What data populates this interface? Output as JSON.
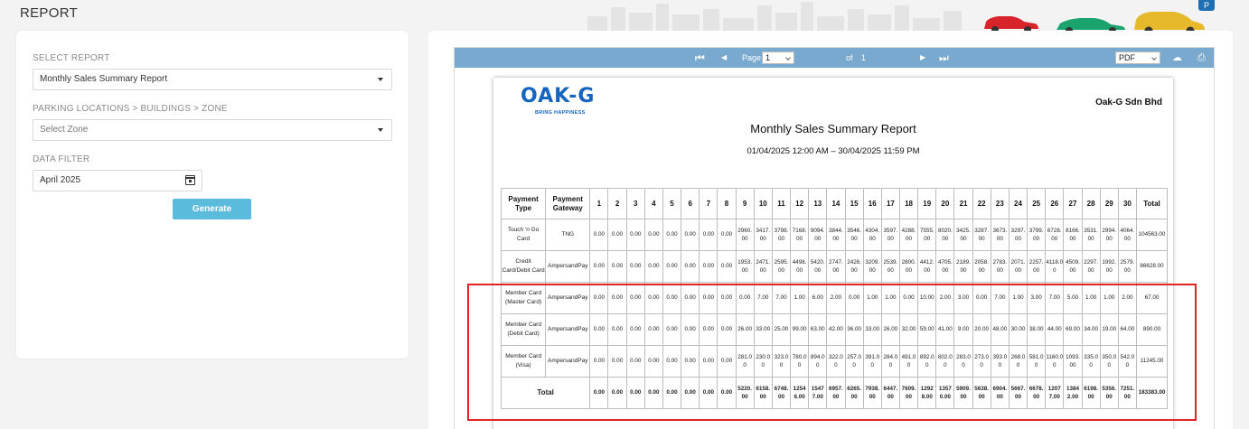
{
  "page": {
    "title": "REPORT"
  },
  "form": {
    "select_report_label": "SELECT REPORT",
    "select_report_value": "Monthly Sales Summary Report",
    "zone_label": "PARKING LOCATIONS > BUILDINGS > ZONE",
    "zone_placeholder": "Select Zone",
    "filter_label": "DATA FILTER",
    "filter_value": "April 2025",
    "generate_label": "Generate"
  },
  "viewer": {
    "page_label": "Page",
    "page_value": "1",
    "of_label": "of",
    "total_pages": "1",
    "format_value": "PDF"
  },
  "report": {
    "logo_text": "OAK-G",
    "logo_tagline": "BRING HAPPINESS",
    "company": "Oak-G Sdn Bhd",
    "title": "Monthly Sales Summary Report",
    "range": "01/04/2025 12:00 AM – 30/04/2025 11:59 PM",
    "headers": [
      "Payment Type",
      "Payment Gateway",
      "1",
      "2",
      "3",
      "4",
      "5",
      "6",
      "7",
      "8",
      "9",
      "10",
      "11",
      "12",
      "13",
      "14",
      "15",
      "16",
      "17",
      "18",
      "19",
      "20",
      "21",
      "22",
      "23",
      "24",
      "25",
      "26",
      "27",
      "28",
      "29",
      "30",
      "Total"
    ],
    "rows": [
      {
        "type": "Touch 'n Go Card",
        "gateway": "TNG",
        "values": [
          "0.00",
          "0.00",
          "0.00",
          "0.00",
          "0.00",
          "0.00",
          "0.00",
          "0.00",
          "2960.00",
          "3417.00",
          "3798.00",
          "7168.00",
          "9094.00",
          "3844.00",
          "3546.00",
          "4304.00",
          "3597.00",
          "4288.00",
          "7555.00",
          "8020.00",
          "3425.00",
          "3287.00",
          "3673.00",
          "3297.00",
          "3799.00",
          "6728.00",
          "8166.00",
          "3531.00",
          "2994.00",
          "4064.00"
        ],
        "total": "104563.00"
      },
      {
        "type": "Credit Card/Debit Card",
        "gateway": "AmpersandPay",
        "values": [
          "0.00",
          "0.00",
          "0.00",
          "0.00",
          "0.00",
          "0.00",
          "0.00",
          "0.00",
          "1953.00",
          "2471.00",
          "2595.00",
          "4498.00",
          "5420.00",
          "2747.00",
          "2426.00",
          "3209.00",
          "2539.00",
          "2800.00",
          "4412.00",
          "4705.00",
          "2189.00",
          "2058.00",
          "2783.00",
          "2071.00",
          "2257.00",
          "4118.00",
          "4509.00",
          "2297.00",
          "1992.00",
          "2579.00"
        ],
        "total": "86628.00"
      },
      {
        "type": "Member Card (Master Card)",
        "gateway": "AmpersandPay",
        "values": [
          "0.00",
          "0.00",
          "0.00",
          "0.00",
          "0.00",
          "0.00",
          "0.00",
          "0.00",
          "0.00",
          "7.00",
          "7.00",
          "1.00",
          "6.00",
          "2.00",
          "0.00",
          "1.00",
          "1.00",
          "0.00",
          "10.00",
          "2.00",
          "3.00",
          "0.00",
          "7.00",
          "1.00",
          "3.00",
          "7.00",
          "5.00",
          "1.00",
          "1.00",
          "2.00"
        ],
        "total": "67.00"
      },
      {
        "type": "Member Card (Debit Card)",
        "gateway": "AmpersandPay",
        "values": [
          "0.00",
          "0.00",
          "0.00",
          "0.00",
          "0.00",
          "0.00",
          "0.00",
          "0.00",
          "26.00",
          "33.00",
          "25.00",
          "99.00",
          "63.00",
          "42.00",
          "36.00",
          "33.00",
          "26.00",
          "32.00",
          "59.00",
          "41.00",
          "9.00",
          "20.00",
          "48.00",
          "30.00",
          "38.00",
          "44.00",
          "69.00",
          "34.00",
          "19.00",
          "64.00"
        ],
        "total": "890.00"
      },
      {
        "type": "Member Card (Visa)",
        "gateway": "AmpersandPay",
        "values": [
          "0.00",
          "0.00",
          "0.00",
          "0.00",
          "0.00",
          "0.00",
          "0.00",
          "0.00",
          "281.00",
          "230.00",
          "323.00",
          "780.00",
          "894.00",
          "322.00",
          "257.00",
          "391.00",
          "284.00",
          "491.00",
          "892.00",
          "802.00",
          "283.00",
          "273.00",
          "393.00",
          "268.00",
          "581.00",
          "1160.00",
          "1093.00",
          "335.00",
          "350.00",
          "542.00"
        ],
        "total": "11245.00"
      }
    ],
    "total_row": {
      "label": "Total",
      "values": [
        "0.00",
        "0.00",
        "0.00",
        "0.00",
        "0.00",
        "0.00",
        "0.00",
        "0.00",
        "5220.00",
        "6158.00",
        "6748.00",
        "12546.00",
        "15477.00",
        "6957.00",
        "6265.00",
        "7938.00",
        "6447.00",
        "7609.00",
        "12928.00",
        "13570.00",
        "5909.00",
        "5638.00",
        "6904.00",
        "5667.00",
        "6678.00",
        "12077.00",
        "13842.00",
        "6198.00",
        "5356.00",
        "7251.00"
      ],
      "total": "183383.00"
    }
  },
  "colors": {
    "accent": "#5bbbdd",
    "toolbar": "#7aa9cf",
    "logo": "#1565c0",
    "highlight": "#e02525"
  }
}
